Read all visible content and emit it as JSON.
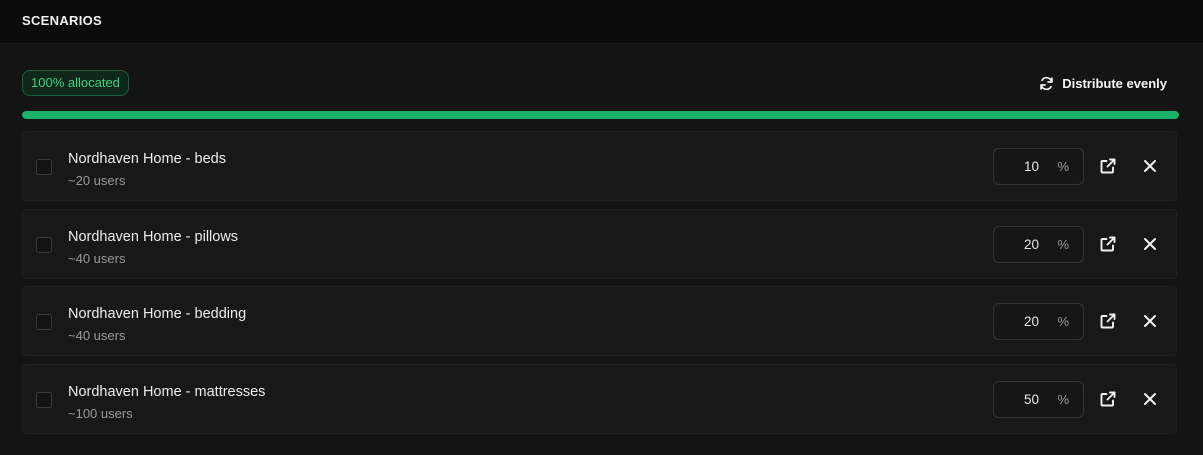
{
  "header": {
    "title": "SCENARIOS"
  },
  "allocation": {
    "badge_label": "100% allocated",
    "progress_fraction": 1.0
  },
  "toolbar": {
    "distribute_label": "Distribute evenly",
    "distribute_icon": "refresh-icon"
  },
  "scenarios": [
    {
      "name": "Nordhaven Home - beds",
      "users": "~20 users",
      "percent": "10",
      "unit": "%"
    },
    {
      "name": "Nordhaven Home - pillows",
      "users": "~40 users",
      "percent": "20",
      "unit": "%"
    },
    {
      "name": "Nordhaven Home - bedding",
      "users": "~40 users",
      "percent": "20",
      "unit": "%"
    },
    {
      "name": "Nordhaven Home - mattresses",
      "users": "~100 users",
      "percent": "50",
      "unit": "%"
    }
  ],
  "row_icons": {
    "open": "external-link-icon",
    "remove": "close-icon"
  },
  "colors": {
    "accent": "#19b26b",
    "badge_text": "#3fd37f",
    "background": "#141414"
  }
}
